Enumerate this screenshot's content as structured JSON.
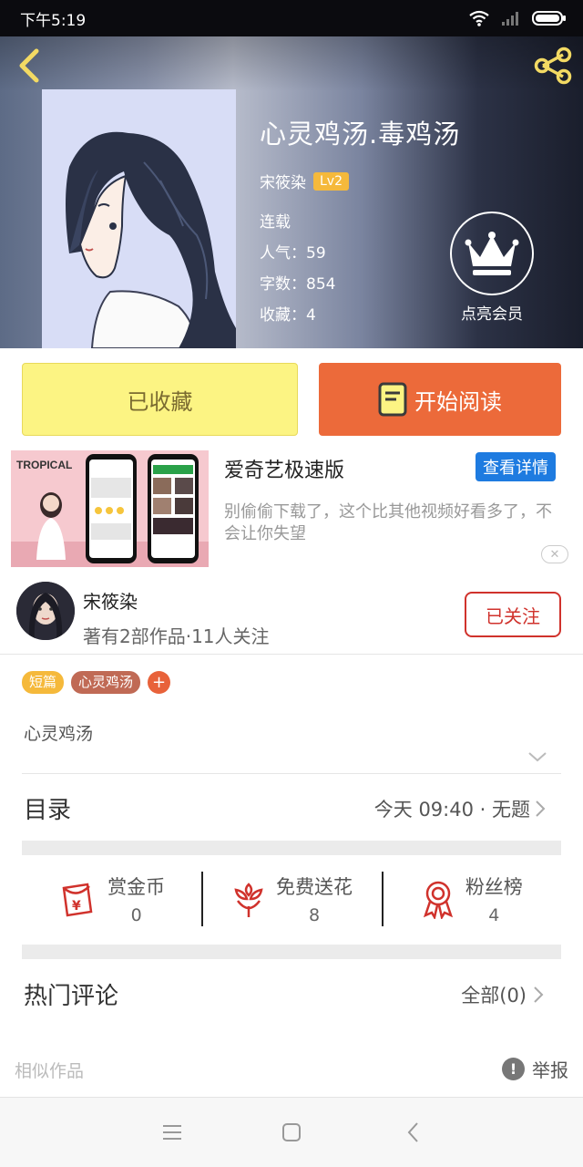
{
  "status_bar": {
    "time": "下午5:19"
  },
  "book": {
    "title": "心灵鸡汤.毒鸡汤",
    "author": "宋筱染",
    "level": "Lv2",
    "status": "连载",
    "popularity": "人气：59",
    "word_count": "字数：854",
    "favorites": "收藏：4"
  },
  "vip": {
    "label": "点亮会员"
  },
  "actions": {
    "collected_label": "已收藏",
    "read_label": "开始阅读"
  },
  "ad": {
    "title": "爱奇艺极速版",
    "button": "查看详情",
    "description": "别偷偷下载了，这个比其他视频好看多了，不会让你失望",
    "thumb_text": "TROPICAL"
  },
  "author_card": {
    "name": "宋筱染",
    "meta": "著有2部作品·11人关注",
    "follow_label": "已关注"
  },
  "tags": [
    {
      "label": "短篇",
      "color": "#f5b93b"
    },
    {
      "label": "心灵鸡汤",
      "color": "#c06a55"
    }
  ],
  "intro": {
    "text": "心灵鸡汤"
  },
  "catalog": {
    "title": "目录",
    "latest": "今天 09:40 · 无题"
  },
  "stats": [
    {
      "label": "赏金币",
      "value": "0",
      "icon": "red-envelope-icon"
    },
    {
      "label": "免费送花",
      "value": "8",
      "icon": "flower-icon"
    },
    {
      "label": "粉丝榜",
      "value": "4",
      "icon": "award-ribbon-icon"
    }
  ],
  "comments": {
    "title": "热门评论",
    "all_label": "全部(0)"
  },
  "footer": {
    "similar": "相似作品",
    "report": "举报"
  },
  "colors": {
    "accent_orange": "#ec6a3a",
    "collect_yellow": "#fcf483",
    "follow_red": "#d0322c",
    "ad_blue": "#1e7be0"
  }
}
